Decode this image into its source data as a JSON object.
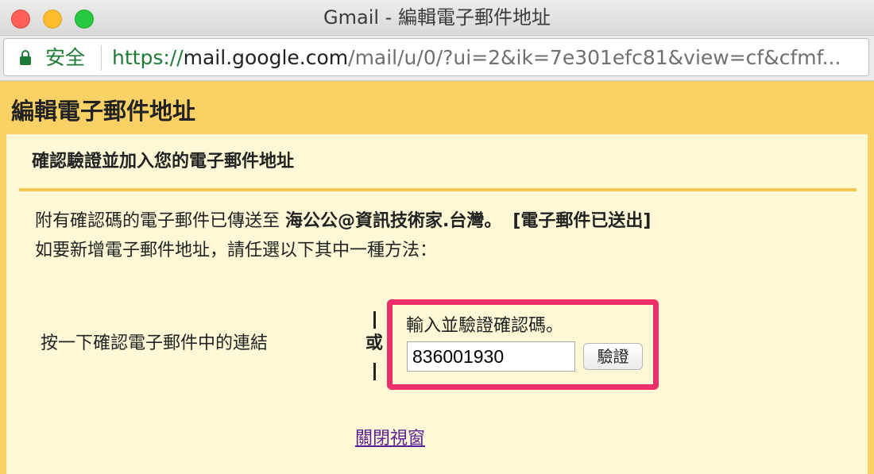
{
  "window": {
    "title": "Gmail - 編輯電子郵件地址"
  },
  "address_bar": {
    "security_label": "安全",
    "url_scheme": "https://",
    "url_host": "mail.google.com",
    "url_path": "/mail/u/0/?ui=2&ik=7e301efc81&view=cf&cfmf..."
  },
  "page": {
    "heading": "編輯電子郵件地址",
    "section_title": "確認驗證並加入您的電子郵件地址",
    "message": {
      "sent_prefix": "附有確認碼的電子郵件已傳送至 ",
      "email": "海公公@資訊技術家.台灣。",
      "sent_status": "[電子郵件已送出]",
      "instruction": "如要新增電子郵件地址，請任選以下其中一種方法："
    },
    "option_link": "按一下確認電子郵件中的連結",
    "or_label": "或",
    "verify": {
      "label": "輸入並驗證確認碼。",
      "code_value": "836001930",
      "button_label": "驗證"
    },
    "close_link": "關閉視窗"
  },
  "colors": {
    "page_background": "#fad165",
    "panel_background": "#fff8d6",
    "highlight_border": "#ee2e6b",
    "secure_green": "#1e7b36",
    "visited_link": "#5b1c96"
  }
}
